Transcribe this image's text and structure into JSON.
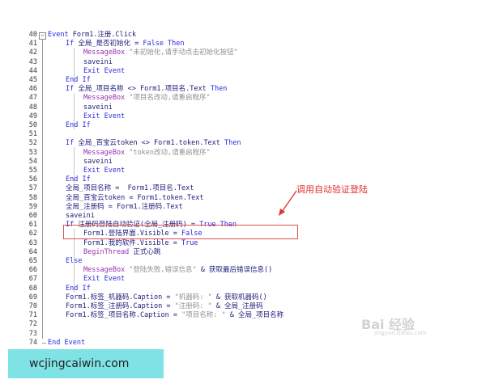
{
  "editor": {
    "lines": [
      {
        "num": "40",
        "parts": [
          {
            "t": "kw",
            "s": "Event "
          },
          {
            "t": "tx",
            "s": "Form1.注册.Click"
          }
        ]
      },
      {
        "num": "41",
        "parts": [
          {
            "t": "kw",
            "s": "If "
          },
          {
            "t": "tx",
            "s": "全局_是否初始化 = "
          },
          {
            "t": "kw",
            "s": "False Then"
          }
        ]
      },
      {
        "num": "42",
        "parts": [
          {
            "t": "fn",
            "s": "MessageBox "
          },
          {
            "t": "str",
            "s": "\"未初始化,请手动点击初始化按钮\""
          }
        ]
      },
      {
        "num": "43",
        "parts": [
          {
            "t": "tx",
            "s": "saveini"
          }
        ]
      },
      {
        "num": "44",
        "parts": [
          {
            "t": "kw",
            "s": "Exit Event"
          }
        ]
      },
      {
        "num": "45",
        "parts": [
          {
            "t": "kw",
            "s": "End If"
          }
        ]
      },
      {
        "num": "46",
        "parts": [
          {
            "t": "kw",
            "s": "If "
          },
          {
            "t": "tx",
            "s": "全局_项目名称 <> Form1.项目名.Text "
          },
          {
            "t": "kw",
            "s": "Then"
          }
        ]
      },
      {
        "num": "47",
        "parts": [
          {
            "t": "fn",
            "s": "MessageBox "
          },
          {
            "t": "str",
            "s": "\"项目名改动,请重启程序\""
          }
        ]
      },
      {
        "num": "48",
        "parts": [
          {
            "t": "tx",
            "s": "saveini"
          }
        ]
      },
      {
        "num": "49",
        "parts": [
          {
            "t": "kw",
            "s": "Exit Event"
          }
        ]
      },
      {
        "num": "50",
        "parts": [
          {
            "t": "kw",
            "s": "End If"
          }
        ]
      },
      {
        "num": "51",
        "parts": []
      },
      {
        "num": "52",
        "parts": [
          {
            "t": "kw",
            "s": "If "
          },
          {
            "t": "tx",
            "s": "全局_百宝云token <> Form1.token.Text "
          },
          {
            "t": "kw",
            "s": "Then"
          }
        ]
      },
      {
        "num": "53",
        "parts": [
          {
            "t": "fn",
            "s": "MessageBox "
          },
          {
            "t": "str",
            "s": "\"token改动,请重启程序\""
          }
        ]
      },
      {
        "num": "54",
        "parts": [
          {
            "t": "tx",
            "s": "saveini"
          }
        ]
      },
      {
        "num": "55",
        "parts": [
          {
            "t": "kw",
            "s": "Exit Event"
          }
        ]
      },
      {
        "num": "56",
        "parts": [
          {
            "t": "kw",
            "s": "End If"
          }
        ]
      },
      {
        "num": "57",
        "parts": [
          {
            "t": "tx",
            "s": "全局_项目名称 =  Form1.项目名.Text"
          }
        ]
      },
      {
        "num": "58",
        "parts": [
          {
            "t": "tx",
            "s": "全局_百宝云token = Form1.token.Text"
          }
        ]
      },
      {
        "num": "59",
        "parts": [
          {
            "t": "tx",
            "s": "全局_注册码 = Form1.注册码.Text"
          }
        ]
      },
      {
        "num": "60",
        "parts": [
          {
            "t": "tx",
            "s": "saveini"
          }
        ]
      },
      {
        "num": "61",
        "parts": [
          {
            "t": "kw",
            "s": "If "
          },
          {
            "t": "tx",
            "s": "注册码登陆自动验证(全局_注册码) = "
          },
          {
            "t": "kw",
            "s": "True Then"
          }
        ]
      },
      {
        "num": "62",
        "parts": [
          {
            "t": "tx",
            "s": "Form1.登陆界面.Visible = "
          },
          {
            "t": "kw",
            "s": "False"
          }
        ]
      },
      {
        "num": "63",
        "parts": [
          {
            "t": "tx",
            "s": "Form1.我的软件.Visible = "
          },
          {
            "t": "kw",
            "s": "True"
          }
        ]
      },
      {
        "num": "64",
        "parts": [
          {
            "t": "fn",
            "s": "BeginThread "
          },
          {
            "t": "tx",
            "s": "正式心跳"
          }
        ]
      },
      {
        "num": "65",
        "parts": [
          {
            "t": "kw",
            "s": "Else"
          }
        ]
      },
      {
        "num": "66",
        "parts": [
          {
            "t": "fn",
            "s": "MessageBox "
          },
          {
            "t": "str",
            "s": "\"登陆失败,错误信息\""
          },
          {
            "t": "tx",
            "s": " & 获取最后错误信息()"
          }
        ]
      },
      {
        "num": "67",
        "parts": [
          {
            "t": "kw",
            "s": "Exit Event"
          }
        ]
      },
      {
        "num": "68",
        "parts": [
          {
            "t": "kw",
            "s": "End If"
          }
        ]
      },
      {
        "num": "69",
        "parts": [
          {
            "t": "tx",
            "s": "Form1.标签_机器码.Caption = "
          },
          {
            "t": "str",
            "s": "\"机器码: \""
          },
          {
            "t": "tx",
            "s": " & 获取机器码()"
          }
        ]
      },
      {
        "num": "70",
        "parts": [
          {
            "t": "tx",
            "s": "Form1.标签_注册码.Caption = "
          },
          {
            "t": "str",
            "s": "\"注册码: \""
          },
          {
            "t": "tx",
            "s": " & 全局_注册码"
          }
        ]
      },
      {
        "num": "71",
        "parts": [
          {
            "t": "tx",
            "s": "Form1.标签_项目名称.Caption = "
          },
          {
            "t": "str",
            "s": "\"项目名称: \""
          },
          {
            "t": "tx",
            "s": " & 全局_项目名称"
          }
        ]
      },
      {
        "num": "72",
        "parts": []
      },
      {
        "num": "73",
        "parts": []
      },
      {
        "num": "74",
        "parts": [
          {
            "t": "kw",
            "s": "End Event"
          }
        ]
      }
    ]
  },
  "annotation": {
    "text": "调用自动验证登陆"
  },
  "watermark": {
    "text": "Bai 经验",
    "sub": "jingyan.baidu.com"
  },
  "site_label": {
    "text": "wcjingcaiwin.com"
  }
}
